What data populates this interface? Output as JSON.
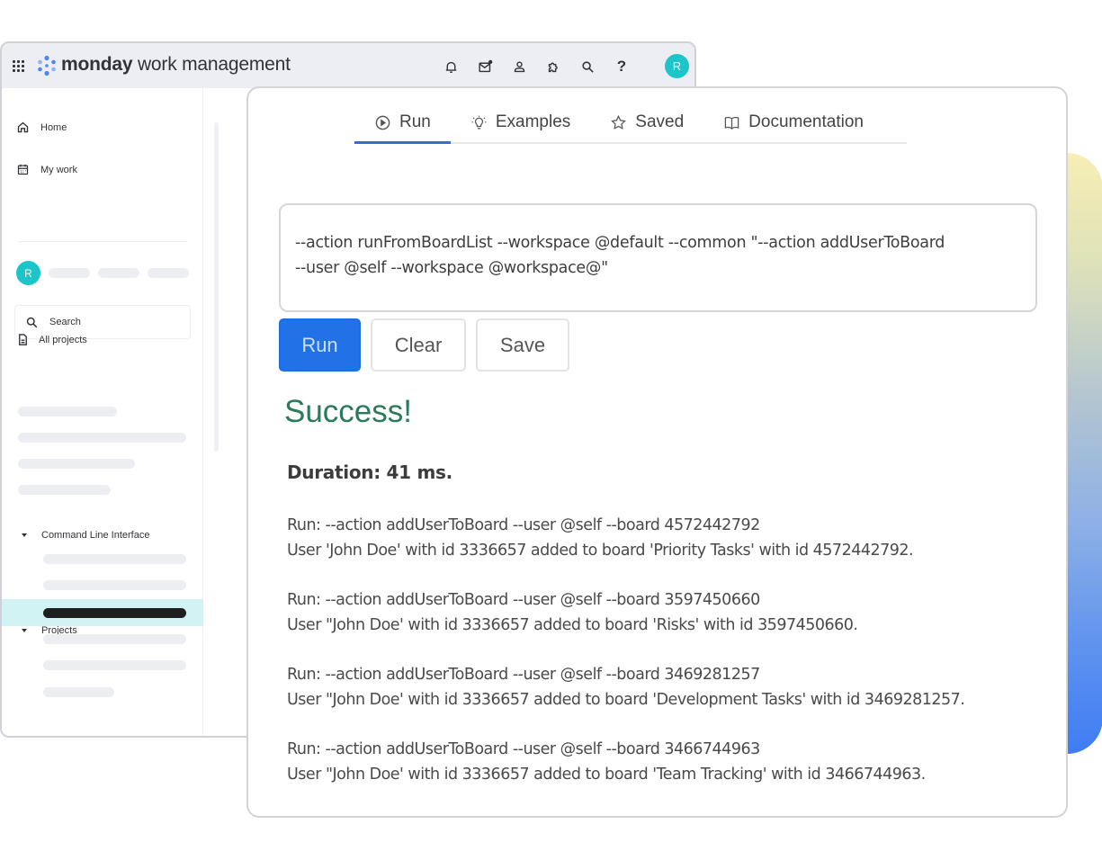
{
  "app": {
    "brand_bold": "monday",
    "brand_rest": " work management",
    "user_initial": "R",
    "topbar_icons": [
      "bell-icon",
      "inbox-icon",
      "person-icon",
      "apps-puzzle-icon",
      "search-icon",
      "help-icon"
    ],
    "topbar_help_glyph": "?"
  },
  "sidebar": {
    "home_label": "Home",
    "my_work_label": "My work",
    "workspace_initial": "R",
    "search_placeholder": "Search",
    "all_projects_label": "All projects",
    "sections": [
      {
        "label": "Command Line Interface",
        "expanded": true
      },
      {
        "label": "Projects",
        "expanded": true
      }
    ]
  },
  "cli": {
    "tabs": [
      {
        "label": "Run",
        "icon": "play-circle-icon",
        "active": true
      },
      {
        "label": "Examples",
        "icon": "lightbulb-icon",
        "active": false
      },
      {
        "label": "Saved",
        "icon": "star-icon",
        "active": false
      },
      {
        "label": "Documentation",
        "icon": "book-icon",
        "active": false
      }
    ],
    "command_line_1": "--action runFromBoardList --workspace @default --common \"--action addUserToBoard",
    "command_line_2": "--user @self --workspace @workspace@\"",
    "buttons": {
      "run": "Run",
      "clear": "Clear",
      "save": "Save"
    },
    "status": "Success!",
    "duration": "Duration: 41 ms.",
    "status_color": "#2b7a5b",
    "accent_color": "#2072e6",
    "results": [
      {
        "run": "Run: --action addUserToBoard --user @self --board 4572442792",
        "message": "User 'John Doe' with id 3336657 added to board 'Priority Tasks' with id 4572442792."
      },
      {
        "run": "Run: --action addUserToBoard --user @self --board 3597450660",
        "message": "User \"John Doe' with id 3336657 added to board 'Risks' with id 3597450660."
      },
      {
        "run": "Run: --action addUserToBoard --user @self --board 3469281257",
        "message": "User \"John Doe' with id 3336657 added to board 'Development Tasks' with id 3469281257."
      },
      {
        "run": "Run: --action addUserToBoard --user @self --board 3466744963",
        "message": "User \"John Doe' with id 3336657 added to board 'Team Tracking' with id 3466744963."
      }
    ]
  }
}
